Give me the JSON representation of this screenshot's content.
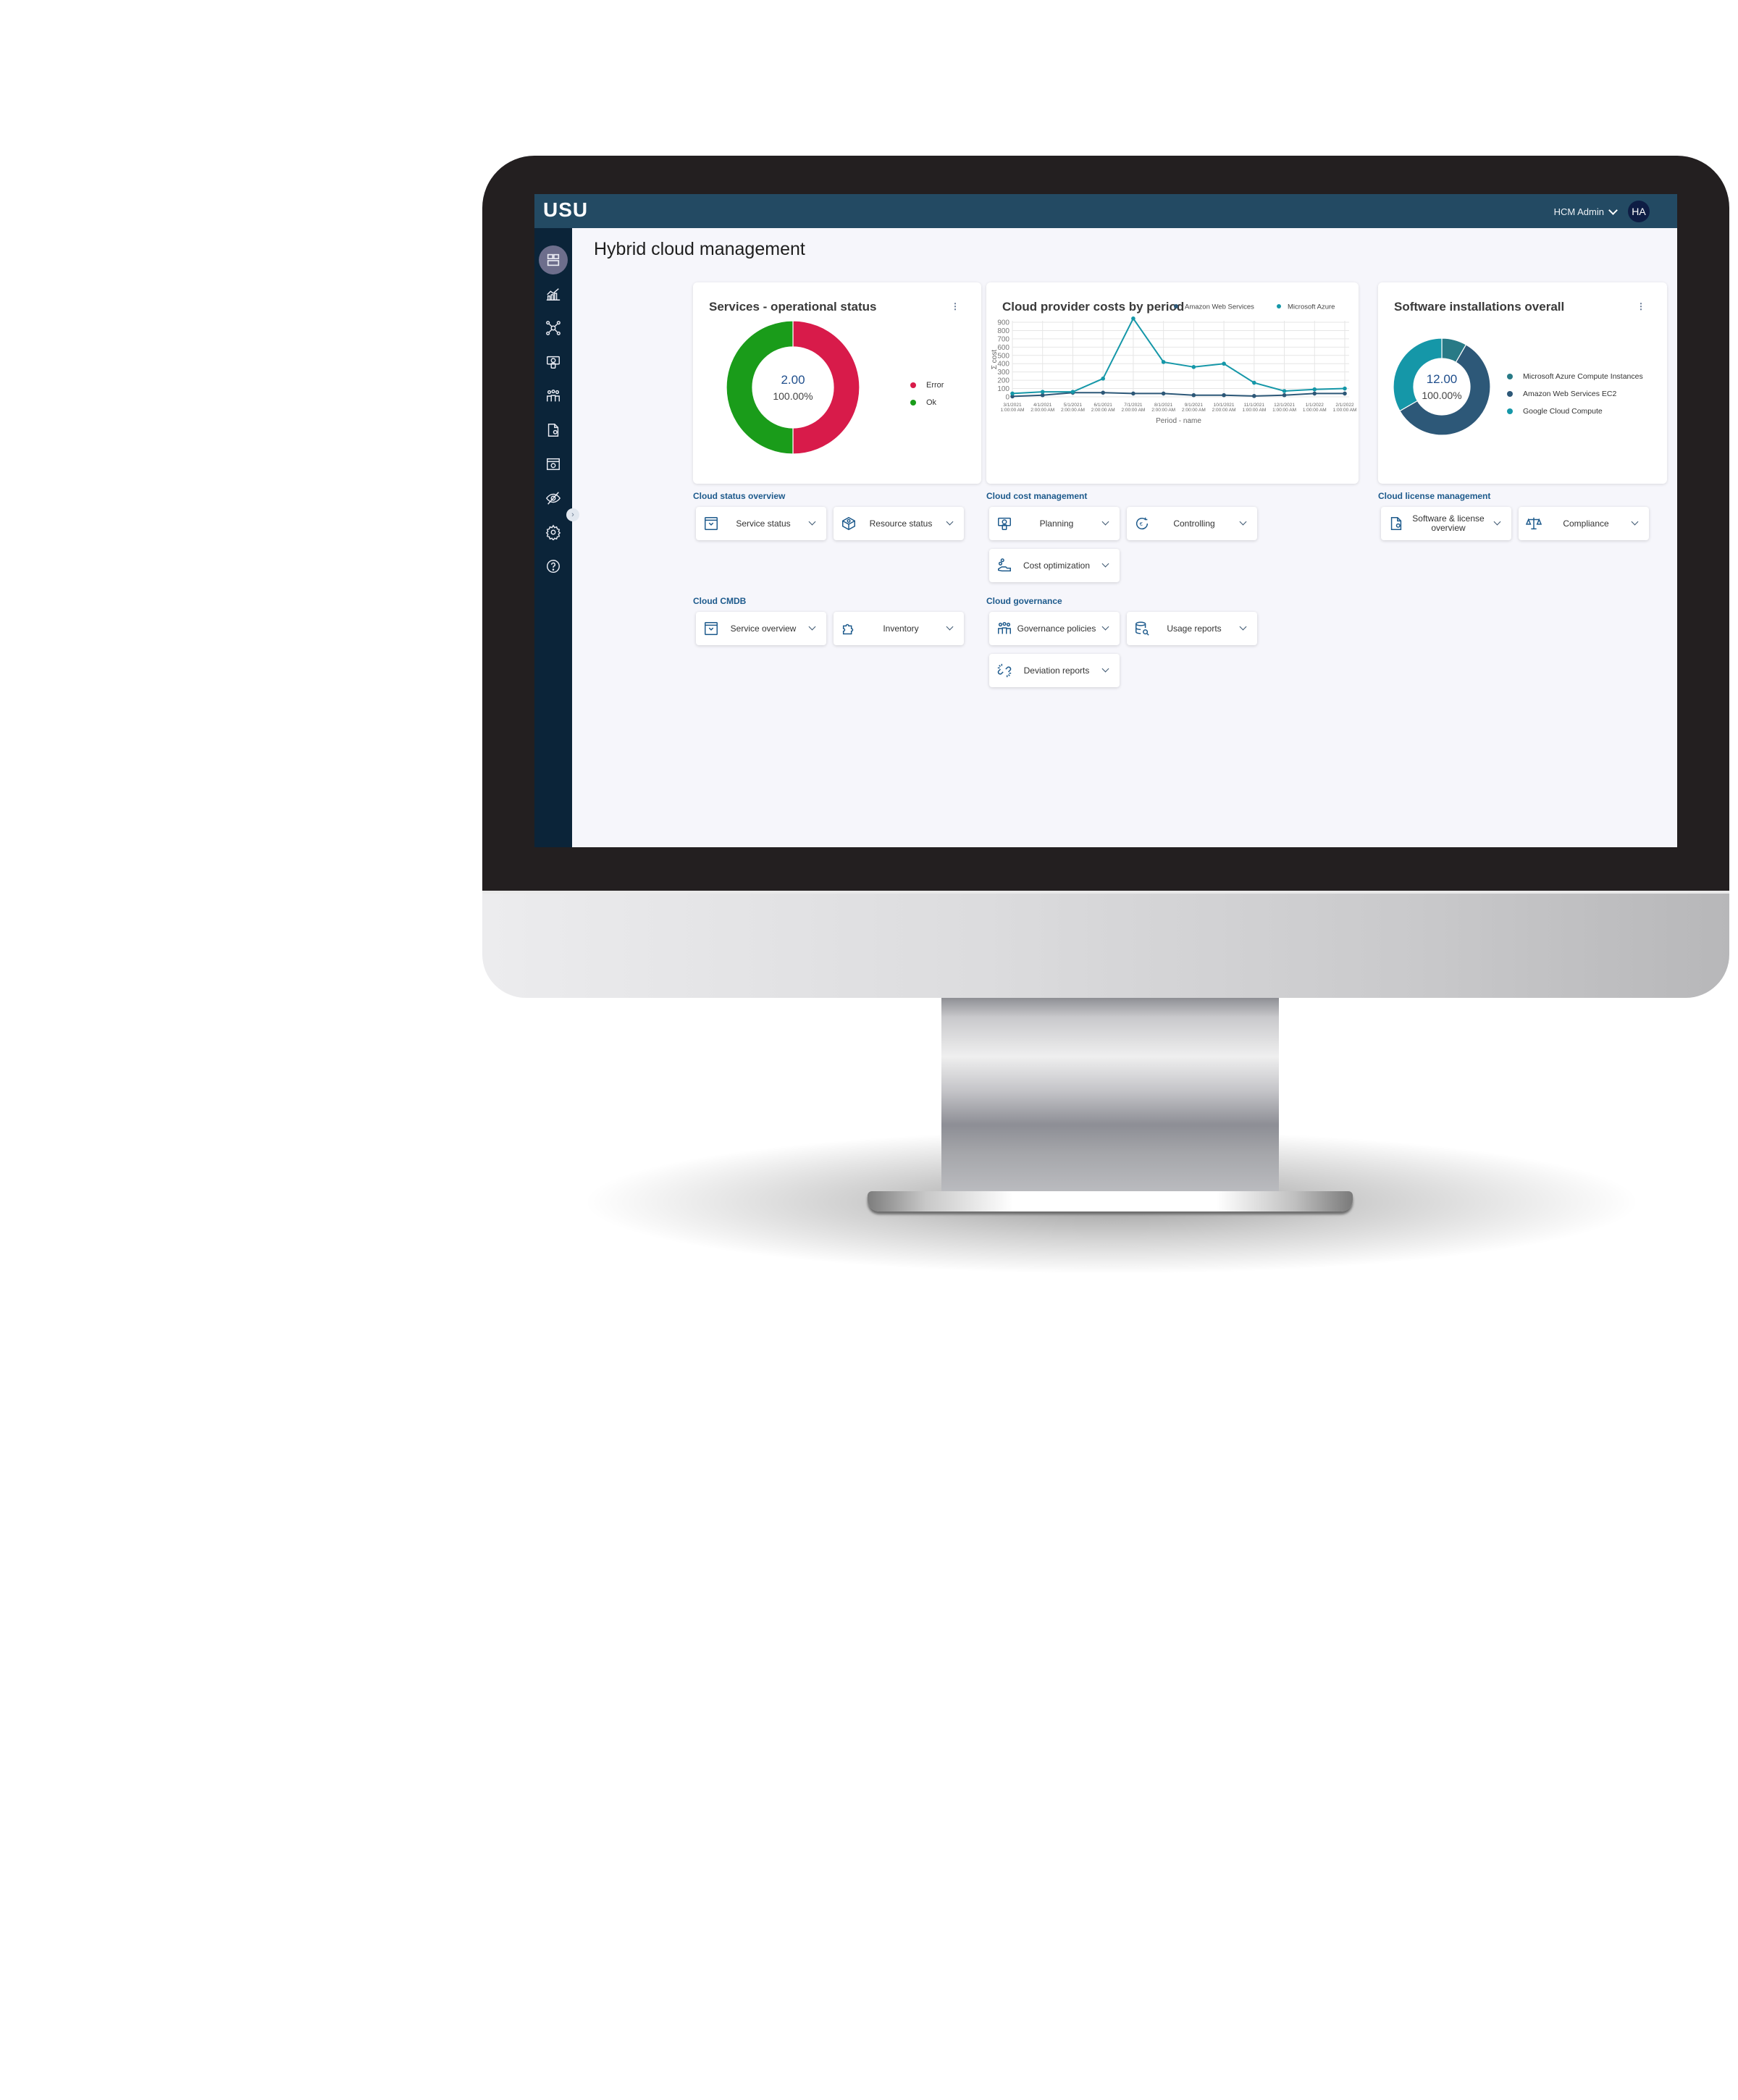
{
  "app": {
    "logo": "USU",
    "page_title": "Hybrid cloud management",
    "user": {
      "name": "HCM Admin",
      "initials": "HA"
    }
  },
  "colors": {
    "header": "#234a63",
    "sidebar": "#0b2439",
    "accent_section": "#1d5a8c",
    "error": "#d81b4a",
    "ok": "#1a9c1a",
    "aws": "#2d5878",
    "azure": "#1597a8"
  },
  "sidebar": {
    "items": [
      {
        "icon": "dashboard-icon",
        "active": true
      },
      {
        "icon": "analytics-chart-icon",
        "active": false
      },
      {
        "icon": "network-nodes-icon",
        "active": false
      },
      {
        "icon": "cost-planning-icon",
        "active": false
      },
      {
        "icon": "people-group-icon",
        "active": false
      },
      {
        "icon": "license-document-icon",
        "active": false
      },
      {
        "icon": "settings-window-icon",
        "active": false
      },
      {
        "icon": "hidden-eye-icon",
        "active": false
      },
      {
        "icon": "gear-icon",
        "active": false
      },
      {
        "icon": "help-icon",
        "active": false
      }
    ],
    "toggle": "›"
  },
  "cards": {
    "services": {
      "title": "Services - operational status",
      "menu": "⋮",
      "center_value": "2.00",
      "center_pct": "100.00%",
      "legend": [
        "Error",
        "Ok"
      ]
    },
    "costs": {
      "title": "Cloud provider costs by period",
      "legend": [
        "Amazon Web Services",
        "Microsoft Azure"
      ]
    },
    "software": {
      "title": "Software installations overall",
      "menu": "⋮",
      "center_value": "12.00",
      "center_pct": "100.00%",
      "legend": [
        "Microsoft Azure Compute Instances",
        "Amazon Web Services EC2",
        "Google Cloud Compute"
      ]
    }
  },
  "sections": {
    "status_overview": {
      "title": "Cloud status overview",
      "tiles": [
        "Service status",
        "Resource status"
      ]
    },
    "cost_management": {
      "title": "Cloud cost management",
      "tiles": [
        "Planning",
        "Controlling",
        "Cost optimization"
      ]
    },
    "license_management": {
      "title": "Cloud license management",
      "tiles": [
        "Software & license overview",
        "Compliance"
      ]
    },
    "cmdb": {
      "title": "Cloud CMDB",
      "tiles": [
        "Service overview",
        "Inventory"
      ]
    },
    "governance": {
      "title": "Cloud governance",
      "tiles": [
        "Governance policies",
        "Usage reports",
        "Deviation reports"
      ]
    }
  },
  "chart_data": [
    {
      "type": "pie",
      "title": "Services - operational status",
      "variant": "donut",
      "categories": [
        "Error",
        "Ok"
      ],
      "values": [
        1,
        1
      ],
      "colors": [
        "#d81b4a",
        "#1a9c1a"
      ],
      "center_label": "2.00",
      "center_sublabel": "100.00%",
      "legend": "right"
    },
    {
      "type": "line",
      "title": "Cloud provider costs by period",
      "xlabel": "Period - name",
      "ylabel": "Σ cost",
      "ylim": [
        0,
        900
      ],
      "yticks": [
        0,
        100,
        200,
        300,
        400,
        500,
        600,
        700,
        800,
        900
      ],
      "grid": true,
      "legend": "top-right",
      "x": [
        [
          "3/1/2021",
          "1:00:00 AM"
        ],
        [
          "4/1/2021",
          "2:00:00 AM"
        ],
        [
          "5/1/2021",
          "2:00:00 AM"
        ],
        [
          "6/1/2021",
          "2:00:00 AM"
        ],
        [
          "7/1/2021",
          "2:00:00 AM"
        ],
        [
          "8/1/2021",
          "2:00:00 AM"
        ],
        [
          "9/1/2021",
          "2:00:00 AM"
        ],
        [
          "10/1/2021",
          "2:00:00 AM"
        ],
        [
          "11/1/2021",
          "1:00:00 AM"
        ],
        [
          "12/1/2021",
          "1:00:00 AM"
        ],
        [
          "1/1/2022",
          "1:00:00 AM"
        ],
        [
          "2/1/2022",
          "1:00:00 AM"
        ]
      ],
      "series": [
        {
          "name": "Amazon Web Services",
          "color": "#2d5878",
          "values": [
            5,
            20,
            50,
            50,
            40,
            40,
            20,
            20,
            10,
            20,
            40,
            40
          ]
        },
        {
          "name": "Microsoft Azure",
          "color": "#1597a8",
          "values": [
            40,
            60,
            60,
            220,
            950,
            420,
            360,
            400,
            170,
            70,
            90,
            100
          ]
        }
      ]
    },
    {
      "type": "pie",
      "title": "Software installations overall",
      "variant": "donut",
      "categories": [
        "Microsoft Azure Compute Instances",
        "Amazon Web Services EC2",
        "Google Cloud Compute"
      ],
      "values": [
        1,
        7,
        4
      ],
      "colors": [
        "#287a86",
        "#2d5878",
        "#1597a8"
      ],
      "center_label": "12.00",
      "center_sublabel": "100.00%",
      "legend": "right"
    }
  ]
}
